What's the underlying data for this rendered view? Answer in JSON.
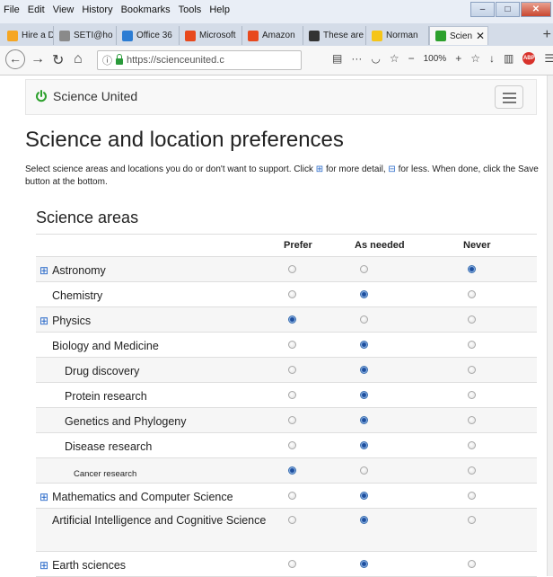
{
  "browser": {
    "menu": [
      "File",
      "Edit",
      "View",
      "History",
      "Bookmarks",
      "Tools",
      "Help"
    ],
    "tabs": [
      {
        "label": "Hire a Da",
        "icon_color": "#f5a623"
      },
      {
        "label": "SETI@ho",
        "icon_color": "#8a8a8a"
      },
      {
        "label": "Office 36",
        "icon_color": "#2b7cd3"
      },
      {
        "label": "Microsoft",
        "icon_color": "#e8491d"
      },
      {
        "label": "Amazon",
        "icon_color": "#e8491d"
      },
      {
        "label": "These are",
        "icon_color": "#333333"
      },
      {
        "label": "Norman",
        "icon_color": "#f5c518"
      },
      {
        "label": "Scien",
        "icon_color": "#2ca02c"
      }
    ],
    "url": "https://scienceunited.c",
    "zoom": "100%"
  },
  "site": {
    "brand": "Science United",
    "accent": "#2ca02c"
  },
  "page": {
    "title": "Science and location preferences",
    "intro_a": "Select science areas and locations you do or don't want to support. Click",
    "intro_b": "for more detail,",
    "intro_c": "for less. When done, click the Save button at the bottom.",
    "expand_symbol": "⊞",
    "collapse_symbol": "⊟",
    "section_title": "Science areas",
    "columns": [
      "Prefer",
      "As needed",
      "Never"
    ],
    "rows": [
      {
        "name": "Astronomy",
        "level": 0,
        "expandable": true,
        "choice": 2
      },
      {
        "name": "Chemistry",
        "level": 1,
        "expandable": false,
        "choice": 1
      },
      {
        "name": "Physics",
        "level": 0,
        "expandable": true,
        "choice": 0
      },
      {
        "name": "Biology and Medicine",
        "level": 1,
        "expandable": false,
        "choice": 1
      },
      {
        "name": "Drug discovery",
        "level": 2,
        "expandable": false,
        "choice": 1
      },
      {
        "name": "Protein research",
        "level": 2,
        "expandable": false,
        "choice": 1
      },
      {
        "name": "Genetics and Phylogeny",
        "level": 2,
        "expandable": false,
        "choice": 1
      },
      {
        "name": "Disease research",
        "level": 2,
        "expandable": false,
        "choice": 1
      },
      {
        "name": "Cancer research",
        "level": 3,
        "expandable": false,
        "choice": 0
      },
      {
        "name": "Mathematics and Computer Science",
        "level": 0,
        "expandable": true,
        "choice": 1
      },
      {
        "name": "Artificial Intelligence and Cognitive Science",
        "level": 1,
        "expandable": false,
        "choice": 1
      },
      {
        "name": "Earth sciences",
        "level": 0,
        "expandable": true,
        "choice": 1
      }
    ]
  }
}
